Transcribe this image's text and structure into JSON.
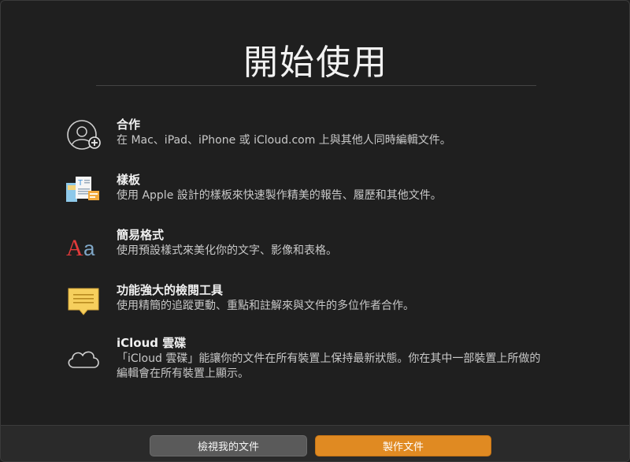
{
  "header": {
    "title": "開始使用"
  },
  "features": [
    {
      "icon": "collaboration-icon",
      "title": "合作",
      "desc": "在 Mac、iPad、iPhone 或 iCloud.com 上與其他人同時編輯文件。"
    },
    {
      "icon": "templates-icon",
      "title": "樣板",
      "desc": "使用 Apple 設計的樣板來快速製作精美的報告、履歷和其他文件。"
    },
    {
      "icon": "styles-icon",
      "title": "簡易格式",
      "desc": "使用預設樣式來美化你的文字、影像和表格。"
    },
    {
      "icon": "review-icon",
      "title": "功能強大的檢閱工具",
      "desc": "使用精簡的追蹤更動、重點和註解來與文件的多位作者合作。"
    },
    {
      "icon": "icloud-icon",
      "title": "iCloud 雲碟",
      "desc": "「iCloud 雲碟」能讓你的文件在所有裝置上保持最新狀態。你在其中一部裝置上所做的編輯會在所有裝置上顯示。"
    }
  ],
  "footer": {
    "secondary_label": "檢視我的文件",
    "primary_label": "製作文件"
  },
  "colors": {
    "accent": "#e08a22",
    "background": "#1f1f1f"
  }
}
